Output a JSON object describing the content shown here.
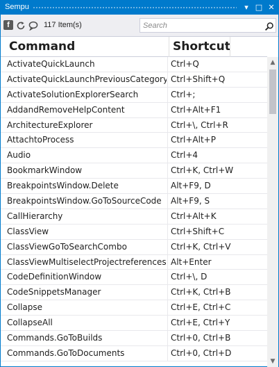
{
  "window": {
    "title": "Sempu",
    "controls": {
      "dropdown": "▾",
      "maximize": "□",
      "close": "✕"
    },
    "accent_color": "#007acc"
  },
  "toolbar": {
    "facebook_glyph": "f",
    "item_count": "117 Item(s)",
    "search_placeholder": "Search",
    "icons": [
      "facebook-icon",
      "refresh-icon",
      "chat-icon",
      "search-icon"
    ]
  },
  "table": {
    "columns": [
      "Command",
      "Shortcut"
    ],
    "rows": [
      [
        "ActivateQuickLaunch",
        "Ctrl+Q"
      ],
      [
        "ActivateQuickLaunchPreviousCategory",
        "Ctrl+Shift+Q"
      ],
      [
        "ActivateSolutionExplorerSearch",
        "Ctrl+;"
      ],
      [
        "AddandRemoveHelpContent",
        "Ctrl+Alt+F1"
      ],
      [
        "ArchitectureExplorer",
        "Ctrl+\\, Ctrl+R"
      ],
      [
        "AttachtoProcess",
        "Ctrl+Alt+P"
      ],
      [
        "Audio",
        "Ctrl+4"
      ],
      [
        "BookmarkWindow",
        "Ctrl+K, Ctrl+W"
      ],
      [
        "BreakpointsWindow.Delete",
        "Alt+F9, D"
      ],
      [
        "BreakpointsWindow.GoToSourceCode",
        "Alt+F9, S"
      ],
      [
        "CallHierarchy",
        "Ctrl+Alt+K"
      ],
      [
        "ClassView",
        "Ctrl+Shift+C"
      ],
      [
        "ClassViewGoToSearchCombo",
        "Ctrl+K, Ctrl+V"
      ],
      [
        "ClassViewMultiselectProjectreferencesIt",
        "Alt+Enter"
      ],
      [
        "CodeDefinitionWindow",
        "Ctrl+\\, D"
      ],
      [
        "CodeSnippetsManager",
        "Ctrl+K, Ctrl+B"
      ],
      [
        "Collapse",
        "Ctrl+E, Ctrl+C"
      ],
      [
        "CollapseAll",
        "Ctrl+E, Ctrl+Y"
      ],
      [
        "Commands.GoToBuilds",
        "Ctrl+0, Ctrl+B"
      ],
      [
        "Commands.GoToDocuments",
        "Ctrl+0, Ctrl+D"
      ]
    ]
  },
  "scrollbar": {
    "up_arrow": "▲",
    "down_arrow": "▼"
  }
}
